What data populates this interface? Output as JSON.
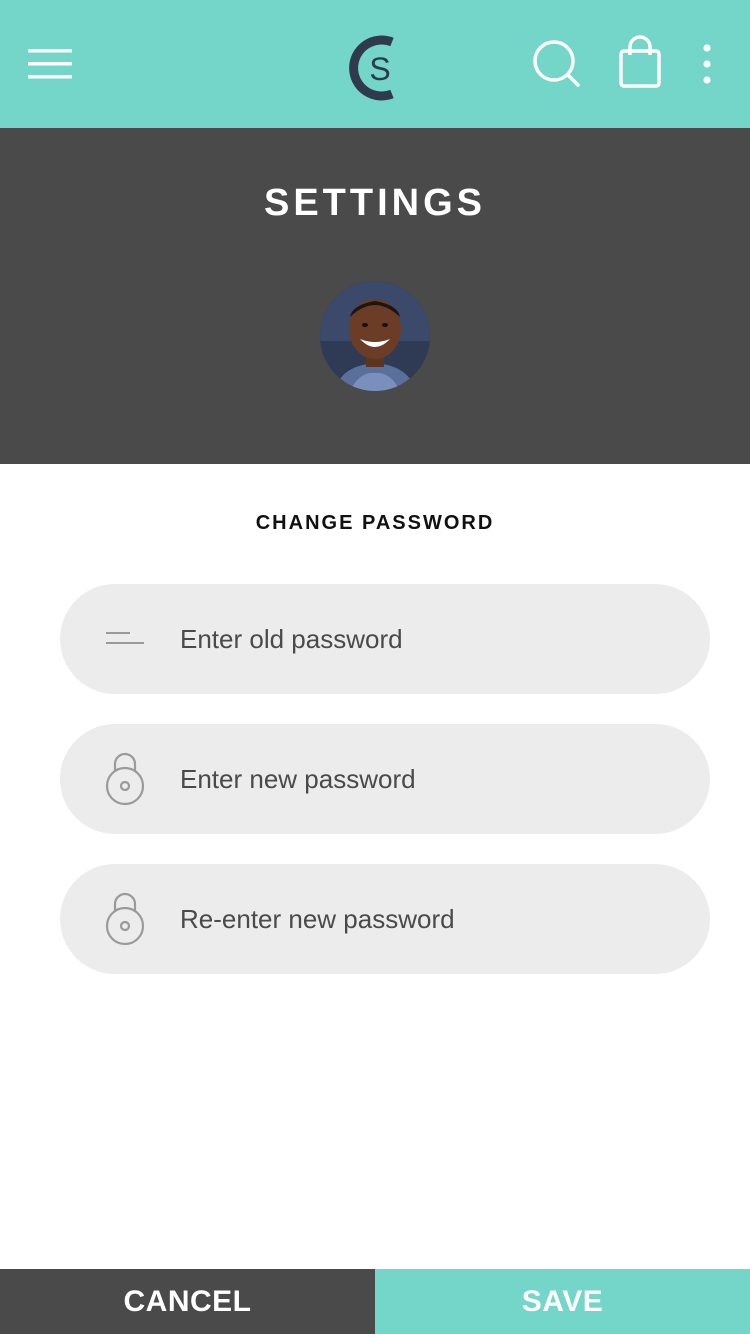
{
  "colors": {
    "accent": "#74d6c9",
    "dark": "#4a4a4a",
    "field_bg": "#ececec",
    "white": "#ffffff"
  },
  "header": {
    "logo_icon": "cs-logo",
    "menu_icon": "hamburger-menu-icon",
    "search_icon": "search-icon",
    "cart_icon": "shopping-bag-icon",
    "more_icon": "more-vertical-icon"
  },
  "hero": {
    "title": "SETTINGS"
  },
  "form": {
    "section_title": "CHANGE PASSWORD",
    "fields": [
      {
        "icon": "password-lines-icon",
        "placeholder": "Enter old password",
        "value": ""
      },
      {
        "icon": "lock-icon",
        "placeholder": "Enter new password",
        "value": ""
      },
      {
        "icon": "lock-icon",
        "placeholder": "Re-enter new password",
        "value": ""
      }
    ]
  },
  "footer": {
    "cancel_label": "CANCEL",
    "save_label": "SAVE"
  }
}
